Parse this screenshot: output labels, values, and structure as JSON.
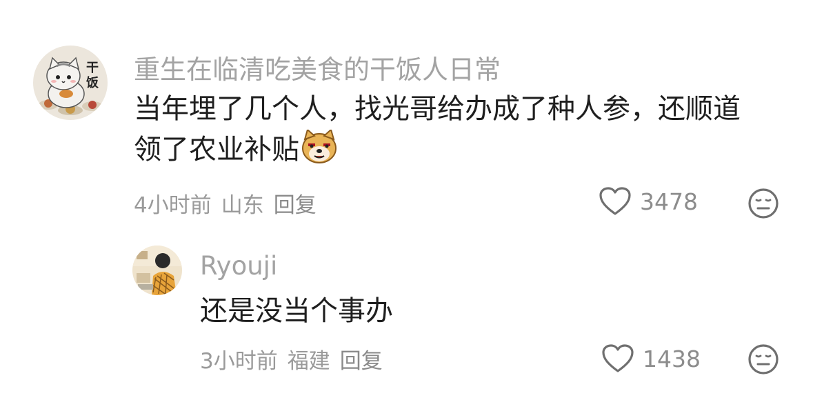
{
  "comments": [
    {
      "username": "重生在临清吃美食的干饭人日常",
      "line1": "当年埋了几个人，找光哥给办成了种人参，还顺道",
      "line2": "领了农业补贴",
      "inline_emoji": "doge-emoji",
      "time": "4小时前",
      "location": "山东",
      "reply_label": "回复",
      "likes": "3478",
      "avatar_text": "干饭"
    },
    {
      "username": "Ryouji",
      "text": "还是没当个事办",
      "time": "3小时前",
      "location": "福建",
      "reply_label": "回复",
      "likes": "1438"
    }
  ],
  "icons": {
    "like": "heart-outline-icon",
    "dislike": "meh-face-icon"
  },
  "colors": {
    "text": "#1f1f1f",
    "username": "#a3a3a3",
    "meta": "#9a9a9a",
    "icon": "#6f6f6f"
  }
}
